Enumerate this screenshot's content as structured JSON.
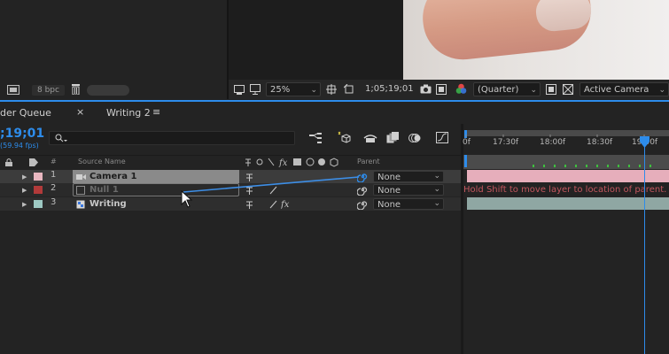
{
  "viewer": {
    "bpc_label": "8 bpc",
    "zoom": "25%",
    "timecode": "1;05;19;01",
    "resolution": "(Quarter)",
    "view": "Active Camera"
  },
  "tabs": {
    "render_queue": "der Queue",
    "comp_close": "×",
    "comp_title": "Writing 2",
    "menu": "≡"
  },
  "timeline": {
    "current_time": ";19;01",
    "fps": "(59.94 fps)",
    "search_placeholder": "",
    "ruler_labels": [
      "0f",
      "17:30f",
      "18:00f",
      "18:30f",
      "19:00f"
    ],
    "tooltip": "Hold Shift to move layer to location of parent. H"
  },
  "columns": {
    "hash": "#",
    "source_name": "Source Name",
    "parent": "Parent"
  },
  "layers": [
    {
      "num": "1",
      "name": "Camera 1",
      "label_color": "#e9b7c0",
      "parent": "None",
      "type": "camera"
    },
    {
      "num": "2",
      "name": "Null 1",
      "label_color": "#b23a3a",
      "parent": "None",
      "type": "null"
    },
    {
      "num": "3",
      "name": "Writing",
      "label_color": "#9ec9c3",
      "parent": "None",
      "type": "comp"
    }
  ],
  "colors": {
    "accent": "#2d8ceb",
    "camera_track": "#e6aebb",
    "comp_track": "#8fa7a3",
    "tooltip_text": "#c2565e"
  }
}
